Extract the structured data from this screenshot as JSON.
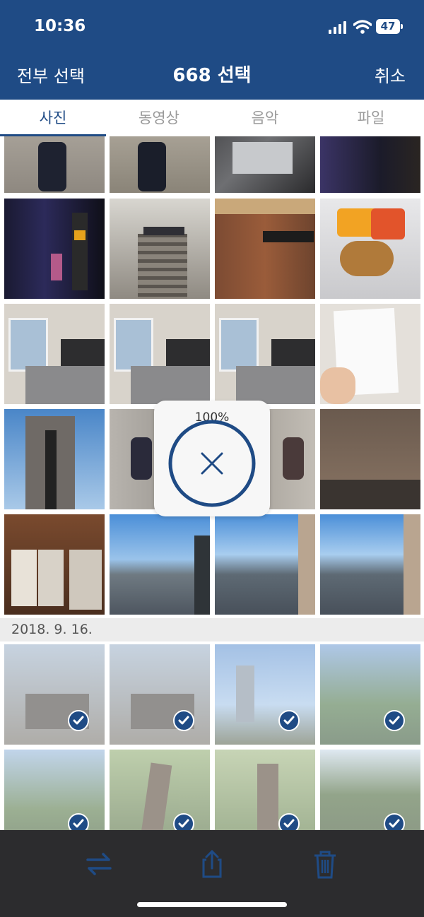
{
  "status": {
    "time": "10:36",
    "battery": "47"
  },
  "navbar": {
    "select_all": "전부 선택",
    "title": "668 선택",
    "cancel": "취소"
  },
  "tabs": [
    {
      "label": "사진",
      "active": true
    },
    {
      "label": "동영상",
      "active": false
    },
    {
      "label": "음악",
      "active": false
    },
    {
      "label": "파일",
      "active": false
    }
  ],
  "progress": {
    "label": "100%",
    "value": 1.0
  },
  "date_section": {
    "label": "2018. 9. 16."
  },
  "bottom_toolbar": {
    "icons": [
      "transfer-icon",
      "share-icon",
      "trash-icon"
    ]
  },
  "colors": {
    "accent": "#1f4b85",
    "toolbar_bg": "#2c2c2e"
  }
}
